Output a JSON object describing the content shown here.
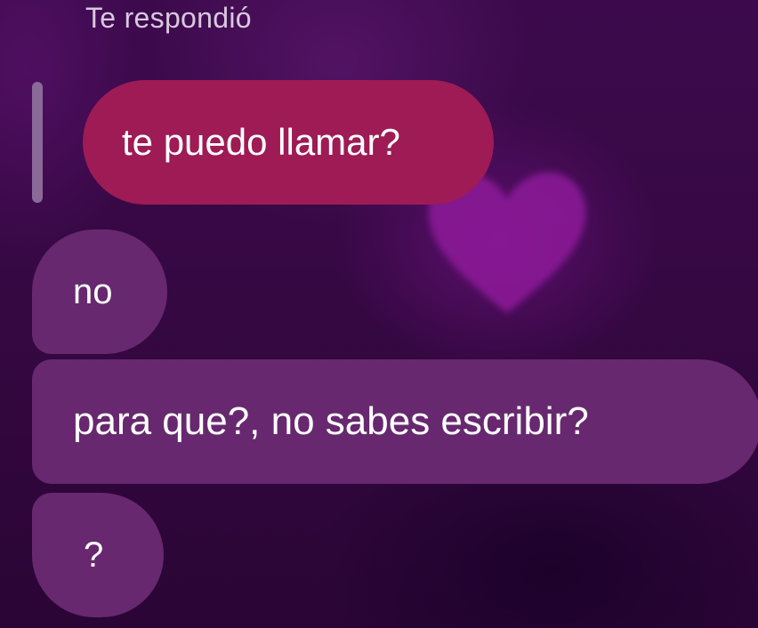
{
  "reply_header": "Te respondió",
  "quoted_message": {
    "text": "te puedo llamar?"
  },
  "messages": [
    {
      "text": "no"
    },
    {
      "text": "para que?, no sabes escribir?"
    },
    {
      "text": "?"
    }
  ],
  "decoration": {
    "icon": "heart-icon",
    "color": "#8e1a9a"
  },
  "colors": {
    "background": "#3a0747",
    "quoted_bubble": "#9e1b55",
    "message_bubble": "#67286f",
    "reply_bar": "#8a6a98",
    "header_text": "#d8c9de"
  }
}
